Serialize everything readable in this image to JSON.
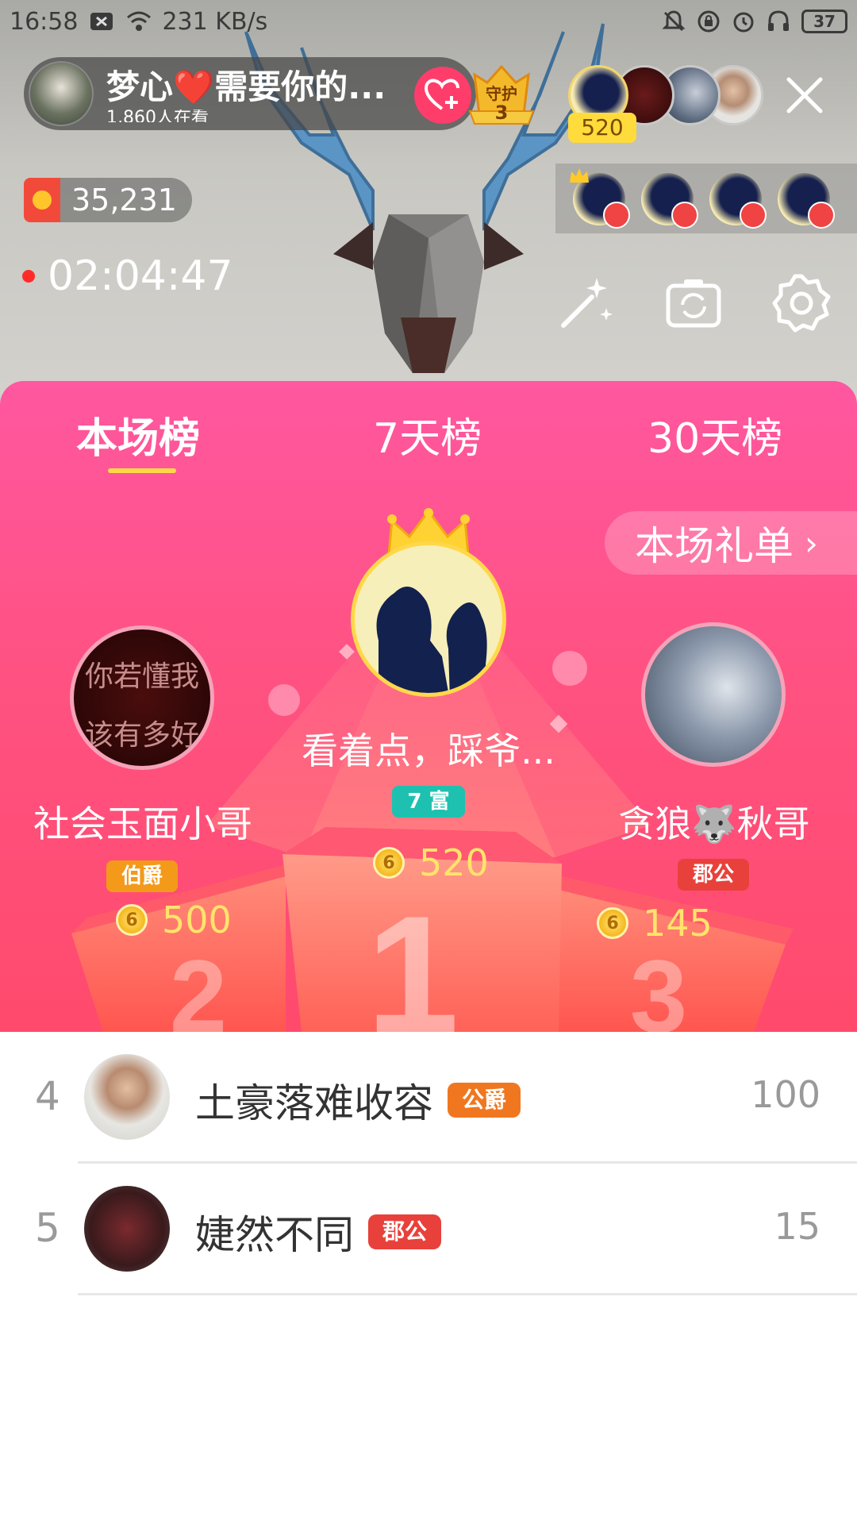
{
  "status_bar": {
    "time": "16:58",
    "speed": "231 KB/s",
    "battery": "37"
  },
  "host": {
    "title": "梦心❤️需要你的...",
    "viewers": "1,860人在看",
    "guard_label": "守护",
    "guard_count": "3"
  },
  "top_viewer": {
    "badge": "520"
  },
  "coins": "35,231",
  "timer": "02:04:47",
  "tabs": [
    {
      "label": "本场榜",
      "active": true
    },
    {
      "label": "7天榜",
      "active": false
    },
    {
      "label": "30天榜",
      "active": false
    }
  ],
  "gift_list_button": "本场礼单",
  "podium": {
    "first": {
      "name": "看着点，踩爷...",
      "badge": "7 富",
      "score": "520"
    },
    "second": {
      "name": "社会玉面小哥",
      "badge": "伯爵",
      "score": "500",
      "avatar_text": [
        "你若懂我",
        "该有多好"
      ]
    },
    "third": {
      "name": "贪狼🐺秋哥",
      "badge": "郡公",
      "score": "145"
    }
  },
  "ranking_list": [
    {
      "rank": "4",
      "name": "土豪落难收容",
      "title": "公爵",
      "score": "100"
    },
    {
      "rank": "5",
      "name": "婕然不同",
      "title": "郡公",
      "score": "15"
    }
  ],
  "colors": {
    "panel_top": "#ff57a0",
    "panel_bottom": "#ff4a6c",
    "score_yellow": "#ffe46b",
    "tab_underline": "#ffd84a",
    "badge_gold": "#f39a1a",
    "badge_red": "#e8413b",
    "badge_teal": "#1ec1b0"
  },
  "icons": [
    "mute-icon",
    "wifi-icon",
    "alarm-icon",
    "headphones-icon",
    "heart-plus-icon",
    "close-icon",
    "magic-wand-icon",
    "camera-flip-icon",
    "gear-icon",
    "crown-icon",
    "coin-icon"
  ]
}
